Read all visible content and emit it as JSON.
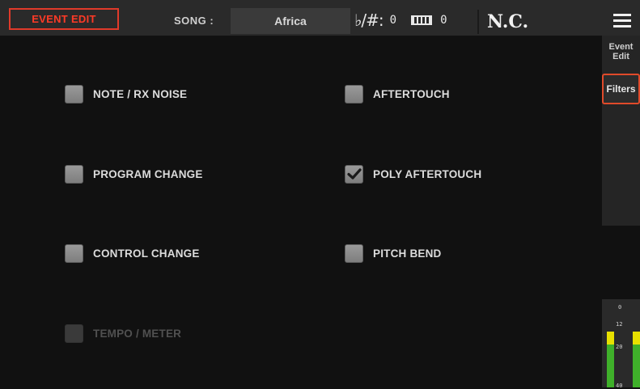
{
  "header": {
    "mode_button": "EVENT EDIT",
    "song_label": "SONG :",
    "song_name": "Africa",
    "accidental": "♭/#:",
    "transpose_value": "0",
    "keyboard_transpose_value": "0",
    "chord": "N.C."
  },
  "sidebar": {
    "tabs": [
      {
        "label_line1": "Event",
        "label_line2": "Edit"
      },
      {
        "label": "Filters",
        "selected": true
      }
    ]
  },
  "meter": {
    "scale": [
      "0",
      "12",
      "20",
      "40"
    ],
    "left_level": 0.63,
    "right_level": 0.63
  },
  "filters": {
    "left": [
      {
        "label": "NOTE / RX NOISE",
        "checked": false,
        "enabled": true
      },
      {
        "label": "PROGRAM CHANGE",
        "checked": false,
        "enabled": true
      },
      {
        "label": "CONTROL CHANGE",
        "checked": false,
        "enabled": true
      },
      {
        "label": "TEMPO / METER",
        "checked": false,
        "enabled": false
      }
    ],
    "right": [
      {
        "label": "AFTERTOUCH",
        "checked": false,
        "enabled": true
      },
      {
        "label": "POLY AFTERTOUCH",
        "checked": true,
        "enabled": true
      },
      {
        "label": "PITCH BEND",
        "checked": false,
        "enabled": true
      }
    ]
  },
  "colors": {
    "accent": "#e03a2a",
    "meter_green": "#3fb02a",
    "meter_yellow": "#e8e000"
  }
}
